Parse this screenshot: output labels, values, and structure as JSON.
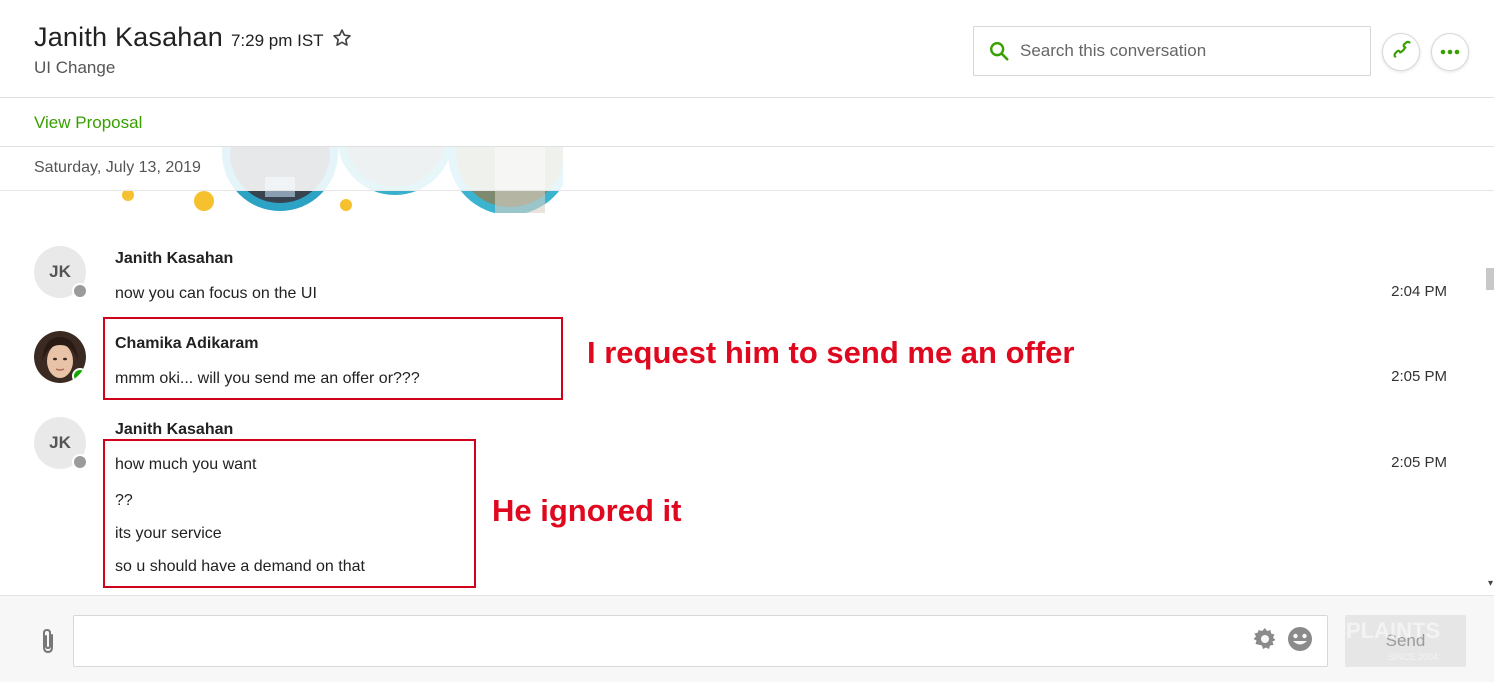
{
  "header": {
    "contact_name": "Janith Kasahan",
    "local_time": "7:29 pm IST",
    "subtitle": "UI Change",
    "search_placeholder": "Search this conversation",
    "accent_color": "#37a000"
  },
  "proposal": {
    "link_label": "View Proposal"
  },
  "date_divider": "Saturday, July 13, 2019",
  "messages": [
    {
      "avatar_initials": "JK",
      "sender": "Janith Kasahan",
      "lines": [
        "now you can focus on the UI"
      ],
      "time": "2:04 PM",
      "status": "offline"
    },
    {
      "avatar_initials": "",
      "sender": "Chamika Adikaram",
      "lines": [
        "mmm oki... will you send me an offer or???"
      ],
      "time": "2:05 PM",
      "status": "online"
    },
    {
      "avatar_initials": "JK",
      "sender": "Janith Kasahan",
      "lines": [
        "how much you want",
        "??",
        "its your service",
        "so u should have a demand on that"
      ],
      "time": "2:05 PM",
      "status": "offline"
    }
  ],
  "annotations": {
    "first": "I request him to send me an offer",
    "second": "He ignored it",
    "color": "#e0081f"
  },
  "composer": {
    "send_label": "Send"
  },
  "watermark": {
    "line1": "PLAINTS",
    "line2": "SINCE 2004"
  }
}
